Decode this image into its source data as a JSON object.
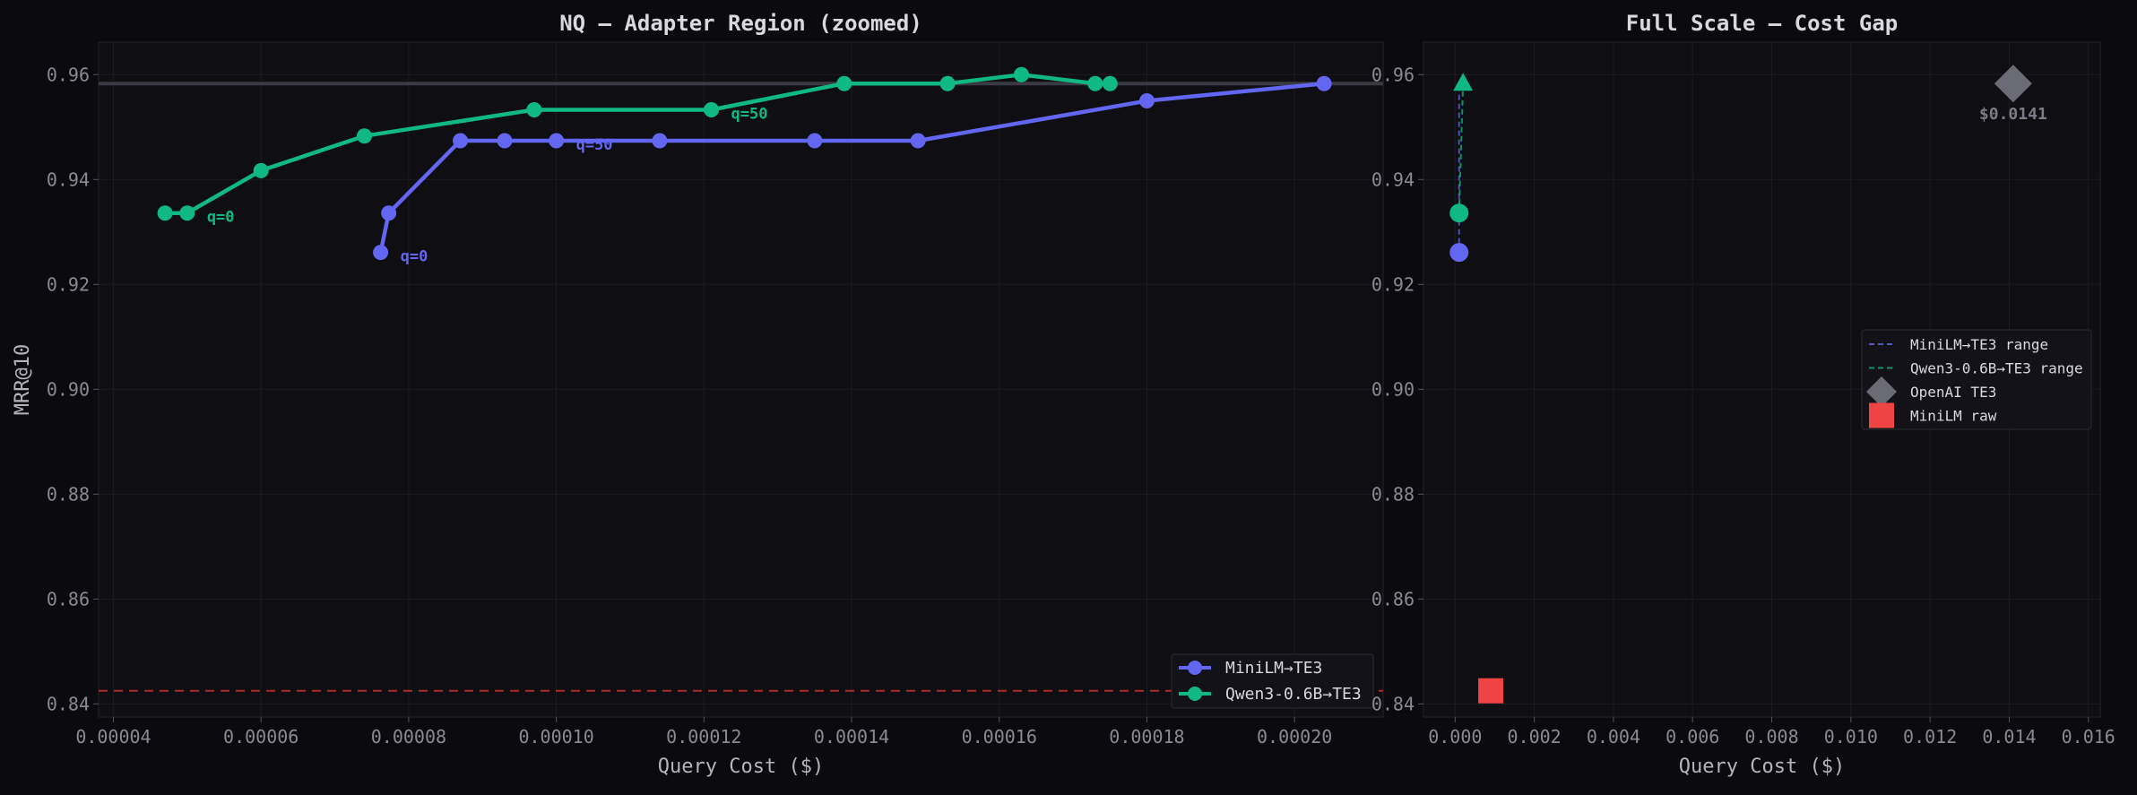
{
  "colors": {
    "background": "#0a0a0f",
    "panel": "#0e0e13",
    "grid": "#1b1b22",
    "axis_text": "#8a8a94",
    "label_text": "#b4b4bc",
    "title_text": "#d8d8de",
    "minilm": "#6366f1",
    "qwen": "#10b981",
    "openai": "#6b6b76",
    "minilm_raw": "#ef4444",
    "ref_line": "#3a3a44",
    "raw_line": "#b02a2a"
  },
  "chart_data": [
    {
      "type": "line",
      "title": "NQ — Adapter Region (zoomed)",
      "xlabel": "Query Cost ($)",
      "ylabel": "MRR@10",
      "xlim": [
        3.8e-05,
        0.000212
      ],
      "ylim": [
        0.8375,
        0.9662
      ],
      "xticks": [
        4e-05,
        6e-05,
        8e-05,
        0.0001,
        0.00012,
        0.00014,
        0.00016,
        0.00018,
        0.0002
      ],
      "xtick_labels": [
        "0.00004",
        "0.00006",
        "0.00008",
        "0.00010",
        "0.00012",
        "0.00014",
        "0.00016",
        "0.00018",
        "0.00020"
      ],
      "yticks": [
        0.84,
        0.86,
        0.88,
        0.9,
        0.92,
        0.94,
        0.96
      ],
      "ytick_labels": [
        "0.84",
        "0.86",
        "0.88",
        "0.90",
        "0.92",
        "0.94",
        "0.96"
      ],
      "grid": true,
      "legend_position": "bottom-right",
      "reference_lines": [
        {
          "name": "OpenAI TE3",
          "y": 0.9583,
          "style": "solid"
        },
        {
          "name": "MiniLM raw",
          "y": 0.8425,
          "style": "dashed"
        }
      ],
      "series": [
        {
          "name": "MiniLM→TE3",
          "color_key": "minilm",
          "x": [
            7.62e-05,
            7.73e-05,
            8.7e-05,
            9.3e-05,
            0.0001,
            0.000114,
            0.000135,
            0.000149,
            0.00018,
            0.000204
          ],
          "y": [
            0.9261,
            0.9336,
            0.9474,
            0.9474,
            0.9474,
            0.9474,
            0.9474,
            0.9474,
            0.955,
            0.9583
          ]
        },
        {
          "name": "Qwen3-0.6B→TE3",
          "color_key": "qwen",
          "x": [
            4.7e-05,
            5e-05,
            6e-05,
            7.4e-05,
            9.7e-05,
            0.000121,
            0.000139,
            0.000153,
            0.000163,
            0.000173,
            0.000175
          ],
          "y": [
            0.9336,
            0.9336,
            0.9417,
            0.9483,
            0.9533,
            0.9533,
            0.9583,
            0.9583,
            0.96,
            0.9583,
            0.9583
          ]
        }
      ],
      "annotations": [
        {
          "text": "q=0",
          "series_key": "minilm",
          "x": 7.62e-05,
          "y": 0.9261
        },
        {
          "text": "q=50",
          "series_key": "minilm",
          "x": 0.0001,
          "y": 0.9474
        },
        {
          "text": "q=0",
          "series_key": "qwen",
          "x": 5e-05,
          "y": 0.9336
        },
        {
          "text": "q=50",
          "series_key": "qwen",
          "x": 0.000121,
          "y": 0.9533
        }
      ]
    },
    {
      "type": "scatter",
      "title": "Full Scale — Cost Gap",
      "xlabel": "Query Cost ($)",
      "ylabel": "",
      "xlim": [
        -0.0008,
        0.0163
      ],
      "ylim": [
        0.8375,
        0.9662
      ],
      "xticks": [
        0,
        0.002,
        0.004,
        0.006,
        0.008,
        0.01,
        0.012,
        0.014,
        0.016
      ],
      "xtick_labels": [
        "0.000",
        "0.002",
        "0.004",
        "0.006",
        "0.008",
        "0.010",
        "0.012",
        "0.014",
        "0.016"
      ],
      "yticks": [
        0.84,
        0.86,
        0.88,
        0.9,
        0.92,
        0.94,
        0.96
      ],
      "ytick_labels": [
        "0.84",
        "0.86",
        "0.88",
        "0.90",
        "0.92",
        "0.94",
        "0.96"
      ],
      "grid": true,
      "legend_position": "center-right",
      "ranges": [
        {
          "name": "MiniLM→TE3 range",
          "color_key": "minilm",
          "x": [
            0.0001,
            0.0001
          ],
          "y": [
            0.9261,
            0.9583
          ]
        },
        {
          "name": "Qwen3-0.6B→TE3 range",
          "color_key": "qwen",
          "x": [
            0.0001,
            0.0002
          ],
          "y": [
            0.9336,
            0.9583
          ]
        }
      ],
      "points": [
        {
          "name": "MiniLM→TE3 start",
          "shape": "circle",
          "color_key": "minilm",
          "x": 0.0001,
          "y": 0.9261
        },
        {
          "name": "Qwen3-0.6B→TE3 start",
          "shape": "circle",
          "color_key": "qwen",
          "x": 0.0001,
          "y": 0.9336
        },
        {
          "name": "Qwen3-0.6B→TE3 end",
          "shape": "triangle",
          "color_key": "qwen",
          "x": 0.0002,
          "y": 0.9583
        },
        {
          "name": "OpenAI TE3",
          "shape": "diamond",
          "color_key": "openai",
          "x": 0.0141,
          "y": 0.9583
        },
        {
          "name": "MiniLM raw",
          "shape": "square",
          "color_key": "minilm_raw",
          "x": 0.0009,
          "y": 0.8425
        }
      ],
      "point_labels": [
        {
          "text": "$0.0141",
          "x": 0.0141,
          "y": 0.9583
        }
      ],
      "legend": [
        {
          "label": "MiniLM→TE3 range",
          "marker": "dashed-line",
          "color_key": "minilm"
        },
        {
          "label": "Qwen3-0.6B→TE3 range",
          "marker": "dashed-line",
          "color_key": "qwen"
        },
        {
          "label": "OpenAI TE3",
          "marker": "diamond",
          "color_key": "openai"
        },
        {
          "label": "MiniLM raw",
          "marker": "square",
          "color_key": "minilm_raw"
        }
      ]
    }
  ]
}
